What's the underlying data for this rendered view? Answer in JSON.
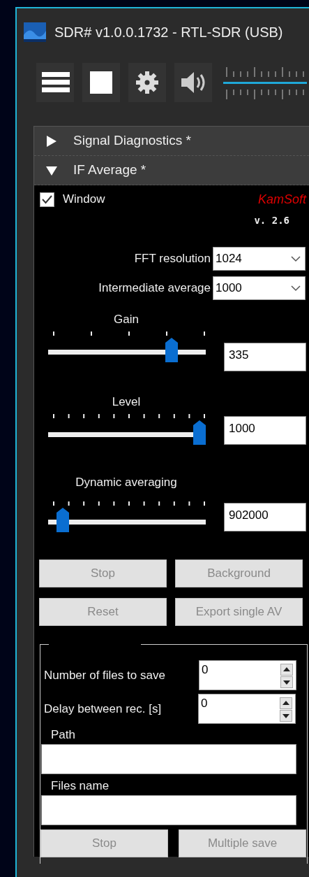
{
  "window": {
    "title": "SDR# v1.0.0.1732 - RTL-SDR (USB)"
  },
  "toolbar": {
    "buttons": [
      {
        "kind": "menu"
      },
      {
        "kind": "stop"
      },
      {
        "kind": "settings"
      },
      {
        "kind": "audio"
      }
    ]
  },
  "panels": [
    {
      "title": "Signal Diagnostics *",
      "expanded": false
    },
    {
      "title": "IF Average *",
      "expanded": true
    }
  ],
  "if_average": {
    "window_checkbox": {
      "label": "Window",
      "checked": true
    },
    "brand": "KamSoft",
    "version": "v. 2.6",
    "selects": [
      {
        "label": "FFT resolution",
        "value": "1024"
      },
      {
        "label": "Intermediate average",
        "value": "1000"
      }
    ],
    "sliders": [
      {
        "label": "Gain",
        "kind": "coarse",
        "level": 0.81,
        "value": "335"
      },
      {
        "label": "Level",
        "kind": "fine",
        "level": 1.0,
        "value": "1000"
      },
      {
        "label": "Dynamic averaging",
        "kind": "fine",
        "level": 0.06,
        "value": "902000"
      }
    ],
    "buttons": [
      {
        "label": "Stop",
        "disabled": true
      },
      {
        "label": "Background",
        "disabled": true
      },
      {
        "label": "Reset",
        "disabled": true
      },
      {
        "label": "Export single AV",
        "disabled": true
      }
    ],
    "save_group": {
      "spinners": [
        {
          "label": "Number of files to save",
          "value": "0"
        },
        {
          "label": "Delay between rec. [s]",
          "value": "0"
        }
      ],
      "fields": [
        {
          "label": "Path"
        },
        {
          "label": "Files name"
        }
      ],
      "buttons": [
        {
          "label": "Stop",
          "disabled": true
        },
        {
          "label": "Multiple save",
          "disabled": true
        }
      ]
    }
  }
}
